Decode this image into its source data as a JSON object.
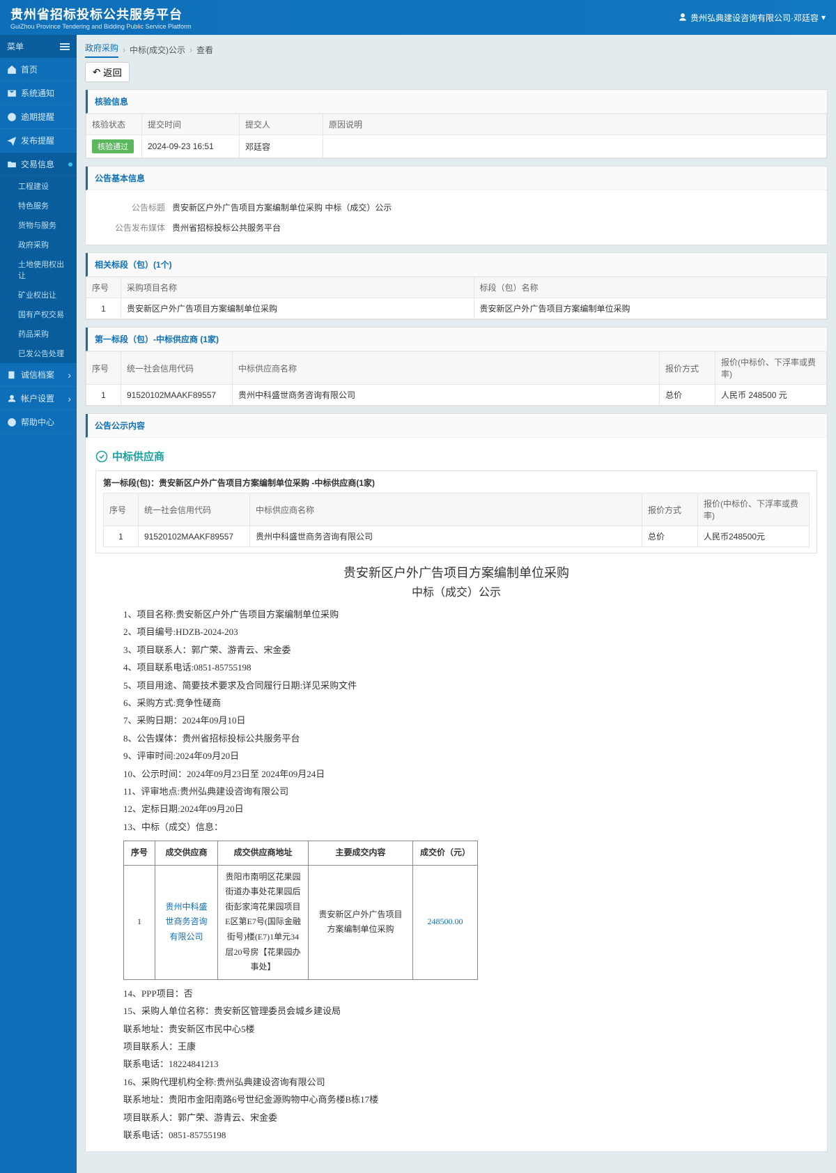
{
  "header": {
    "title_cn": "贵州省招标投标公共服务平台",
    "title_en": "GuiZhou Province Tendering and Bidding Public Service Platform",
    "user": "贵州弘典建设咨询有限公司·邓廷容"
  },
  "sidebar": {
    "menu_label": "菜单",
    "items": [
      {
        "icon": "home",
        "label": "首页"
      },
      {
        "icon": "mail",
        "label": "系统通知"
      },
      {
        "icon": "clock",
        "label": "逾期提醒"
      },
      {
        "icon": "send",
        "label": "发布提醒"
      },
      {
        "icon": "folder",
        "label": "交易信息",
        "active": true,
        "subs": [
          "工程建设",
          "特色服务",
          "货物与服务",
          "政府采购",
          "土地使用权出让",
          "矿业权出让",
          "国有产权交易",
          "药品采购",
          "已发公告处理"
        ]
      },
      {
        "icon": "book",
        "label": "诚信档案",
        "chev": true
      },
      {
        "icon": "user",
        "label": "帐户设置",
        "chev": true
      },
      {
        "icon": "help",
        "label": "帮助中心"
      }
    ]
  },
  "crumbs": [
    "政府采购",
    "中标(成交)公示",
    "查看"
  ],
  "back_label": "返回",
  "panel1": {
    "title": "核验信息",
    "headers": [
      "核验状态",
      "提交时间",
      "提交人",
      "原因说明"
    ],
    "row": {
      "status": "核验通过",
      "time": "2024-09-23 16:51",
      "submitter": "邓廷容",
      "reason": ""
    }
  },
  "panel2": {
    "title": "公告基本信息",
    "rows": [
      {
        "label": "公告标题",
        "value": "贵安新区户外广告项目方案编制单位采购 中标（成交）公示"
      },
      {
        "label": "公告发布媒体",
        "value": "贵州省招标投标公共服务平台"
      }
    ]
  },
  "panel3": {
    "title": "相关标段（包）(1个)",
    "headers": [
      "序号",
      "采购项目名称",
      "标段（包）名称"
    ],
    "row": [
      "1",
      "贵安新区户外广告项目方案编制单位采购",
      "贵安新区户外广告项目方案编制单位采购"
    ]
  },
  "panel4": {
    "title": "第一标段（包）-中标供应商 (1家)",
    "headers": [
      "序号",
      "统一社会信用代码",
      "中标供应商名称",
      "报价方式",
      "报价(中标价、下浮率或费率)"
    ],
    "row": [
      "1",
      "91520102MAAKF89557",
      "贵州中科盛世商务咨询有限公司",
      "总价",
      "人民币 248500 元"
    ]
  },
  "panel5": {
    "title": "公告公示内容",
    "winner_label": "中标供应商",
    "inner_title": "第一标段(包)：贵安新区户外广告项目方案编制单位采购 -中标供应商(1家)",
    "inner_headers": [
      "序号",
      "统一社会信用代码",
      "中标供应商名称",
      "报价方式",
      "报价(中标价、下浮率或费率)"
    ],
    "inner_row": [
      "1",
      "91520102MAAKF89557",
      "贵州中科盛世商务咨询有限公司",
      "总价",
      "人民币248500元"
    ],
    "doc": {
      "title": "贵安新区户外广告项目方案编制单位采购",
      "subtitle": "中标（成交）公示",
      "lines": [
        "1、项目名称:贵安新区户外广告项目方案编制单位采购",
        "2、项目编号:HDZB-2024-203",
        "3、项目联系人：郭广荣、游青云、宋金委",
        "4、项目联系电话:0851-85755198",
        "5、项目用途、简要技术要求及合同履行日期:详见采购文件",
        "6、采购方式:竞争性磋商",
        "7、采购日期：2024年09月10日",
        "8、公告媒体：贵州省招标投标公共服务平台",
        "9、评审时间:2024年09月20日",
        "10、公示时间：2024年09月23日至 2024年09月24日",
        "11、评审地点:贵州弘典建设咨询有限公司",
        "12、定标日期:2024年09月20日",
        "13、中标（成交）信息："
      ],
      "deal_headers": [
        "序号",
        "成交供应商",
        "成交供应商地址",
        "主要成交内容",
        "成交价（元）"
      ],
      "deal_row": {
        "no": "1",
        "supplier": "贵州中科盛世商务咨询有限公司",
        "addr": "贵阳市南明区花果园街道办事处花果园后街彭家湾花果园项目E区第E7号(国际金融街号)楼(E7)1单元34层20号房【花果园办事处】",
        "content": "贵安新区户外广告项目方案编制单位采购",
        "price": "248500.00"
      },
      "lines2": [
        "14、PPP项目：否",
        "15、采购人单位名称：贵安新区管理委员会城乡建设局",
        "联系地址：贵安新区市民中心5楼",
        "项目联系人：王康",
        "联系电话：18224841213",
        "16、采购代理机构全称:贵州弘典建设咨询有限公司",
        "联系地址：贵阳市金阳南路6号世纪金源购物中心商务楼B栋17楼",
        "项目联系人：郭广荣、游青云、宋金委",
        "联系电话：0851-85755198"
      ]
    }
  }
}
